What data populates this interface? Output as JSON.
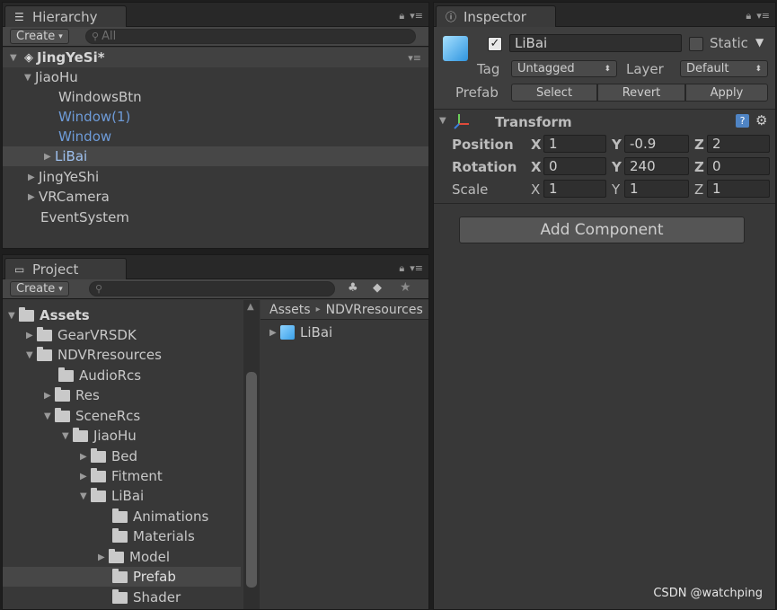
{
  "hierarchy": {
    "tab": "Hierarchy",
    "create": "Create",
    "search_placeholder": "All",
    "scene": "JingYeSi*",
    "items": [
      {
        "label": "JiaoHu"
      },
      {
        "label": "WindowsBtn"
      },
      {
        "label": "Window(1)"
      },
      {
        "label": "Window"
      },
      {
        "label": "LiBai"
      },
      {
        "label": "JingYeShi"
      },
      {
        "label": "VRCamera"
      },
      {
        "label": "EventSystem"
      }
    ]
  },
  "project": {
    "tab": "Project",
    "create": "Create",
    "folders": [
      {
        "label": "Assets"
      },
      {
        "label": "GearVRSDK"
      },
      {
        "label": "NDVRresources"
      },
      {
        "label": "AudioRcs"
      },
      {
        "label": "Res"
      },
      {
        "label": "SceneRcs"
      },
      {
        "label": "JiaoHu"
      },
      {
        "label": "Bed"
      },
      {
        "label": "Fitment"
      },
      {
        "label": "LiBai"
      },
      {
        "label": "Animations"
      },
      {
        "label": "Materials"
      },
      {
        "label": "Model"
      },
      {
        "label": "Prefab"
      },
      {
        "label": "Shader"
      }
    ],
    "breadcrumb": {
      "root": "Assets",
      "sep": "▸",
      "sub": "NDVRresources"
    },
    "assets": [
      {
        "label": "LiBai"
      }
    ]
  },
  "inspector": {
    "tab": "Inspector",
    "name": "LiBai",
    "static_label": "Static",
    "tag_label": "Tag",
    "tag_value": "Untagged",
    "layer_label": "Layer",
    "layer_value": "Default",
    "prefab_label": "Prefab",
    "prefab_buttons": {
      "select": "Select",
      "revert": "Revert",
      "apply": "Apply"
    },
    "transform": {
      "title": "Transform",
      "position": {
        "label": "Position",
        "x": "1",
        "y": "-0.9",
        "z": "2"
      },
      "rotation": {
        "label": "Rotation",
        "x": "0",
        "y": "240",
        "z": "0"
      },
      "scale": {
        "label": "Scale",
        "x": "1",
        "y": "1",
        "z": "1"
      },
      "axis": {
        "x": "X",
        "y": "Y",
        "z": "Z"
      }
    },
    "add_component": "Add Component"
  },
  "watermark": "CSDN @watchping",
  "colors": {
    "panel": "#383838",
    "selection": "#474747",
    "prefab_blue": "#6e9bd8"
  }
}
